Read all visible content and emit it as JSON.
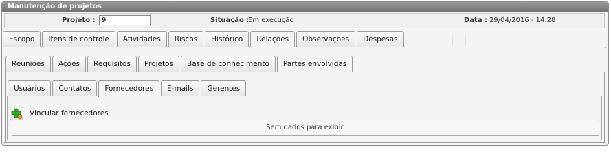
{
  "panel": {
    "title": "Manutenção de projetos"
  },
  "info": {
    "project_label": "Projeto :",
    "project_value": "9",
    "status_label": "Situação :",
    "status_value": "Em execução",
    "date_label": "Data :",
    "date_value": "29/04/2016 - 14:28"
  },
  "main_tabs": [
    {
      "label": "Escopo",
      "active": false
    },
    {
      "label": "Itens de controle",
      "active": false
    },
    {
      "label": "Atividades",
      "active": false
    },
    {
      "label": "Riscos",
      "active": false
    },
    {
      "label": "Histórico",
      "active": false
    },
    {
      "label": "Relações",
      "active": true
    },
    {
      "label": "Observações",
      "active": false
    },
    {
      "label": "Despesas",
      "active": false
    }
  ],
  "relation_tabs": [
    {
      "label": "Reuniões",
      "active": false
    },
    {
      "label": "Ações",
      "active": false
    },
    {
      "label": "Requisitos",
      "active": false
    },
    {
      "label": "Projetos",
      "active": false
    },
    {
      "label": "Base de conhecimento",
      "active": false
    },
    {
      "label": "Partes envolvidas",
      "active": true
    }
  ],
  "party_tabs": [
    {
      "label": "Usuários",
      "active": false
    },
    {
      "label": "Contatos",
      "active": false
    },
    {
      "label": "Fornecedores",
      "active": true
    },
    {
      "label": "E-mails",
      "active": false
    },
    {
      "label": "Gerentes",
      "active": false
    }
  ],
  "suppliers": {
    "link_label": "Vincular fornecedores",
    "empty_text": "Sem dados para exibir.",
    "add_icon": "add-link-icon"
  },
  "colors": {
    "title_bar": "#7f7f7f",
    "add_icon_green": "#3aa52a",
    "add_icon_gold": "#d8a520"
  }
}
